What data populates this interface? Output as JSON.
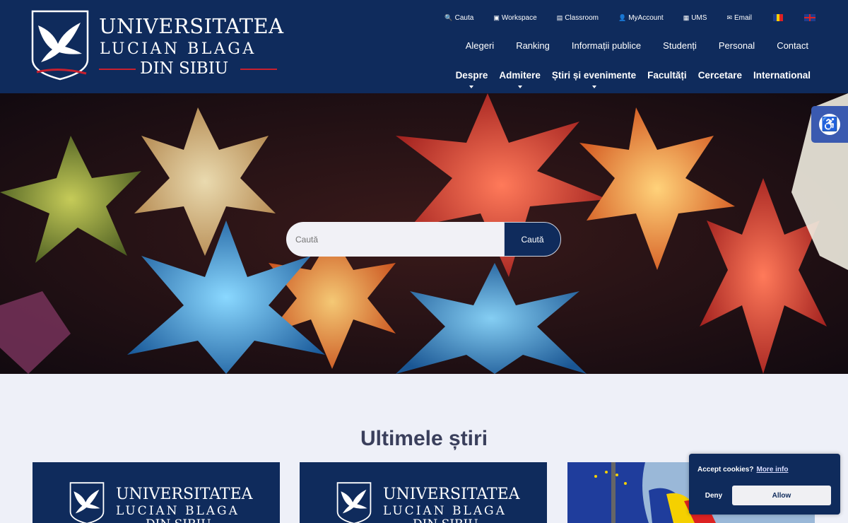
{
  "logo": {
    "line1": "UNIVERSITATEA",
    "line2": "LUCIAN BLAGA",
    "line3": "DIN SIBIU"
  },
  "topbar": [
    {
      "icon": "search-icon",
      "glyph": "🔍",
      "label": "Cauta"
    },
    {
      "icon": "workspace-icon",
      "glyph": "▣",
      "label": "Workspace"
    },
    {
      "icon": "classroom-icon",
      "glyph": "▤",
      "label": "Classroom"
    },
    {
      "icon": "user-icon",
      "glyph": "👤",
      "label": "MyAccount"
    },
    {
      "icon": "ums-icon",
      "glyph": "▦",
      "label": "UMS"
    },
    {
      "icon": "email-icon",
      "glyph": "✉",
      "label": "Email"
    }
  ],
  "nav_secondary": [
    "Alegeri",
    "Ranking",
    "Informații publice",
    "Studenți",
    "Personal",
    "Contact"
  ],
  "nav_main": [
    {
      "label": "Despre",
      "dropdown": true
    },
    {
      "label": "Admitere",
      "dropdown": true
    },
    {
      "label": "Știri și evenimente",
      "dropdown": true
    },
    {
      "label": "Facultăți",
      "dropdown": false
    },
    {
      "label": "Cercetare",
      "dropdown": false
    },
    {
      "label": "International",
      "dropdown": false
    }
  ],
  "search": {
    "placeholder": "Caută",
    "button": "Caută"
  },
  "news": {
    "title": "Ultimele știri"
  },
  "card_logo": {
    "line1": "UNIVERSITATEA",
    "line2": "LUCIAN BLAGA",
    "line3": "DIN SIBIU"
  },
  "cookie": {
    "text": "Accept cookies?",
    "more_info": "More info",
    "deny": "Deny",
    "allow": "Allow"
  },
  "colors": {
    "brand_navy": "#0f2b5c",
    "accent_red": "#c8202f",
    "accessibility": "#3a5ab0"
  }
}
